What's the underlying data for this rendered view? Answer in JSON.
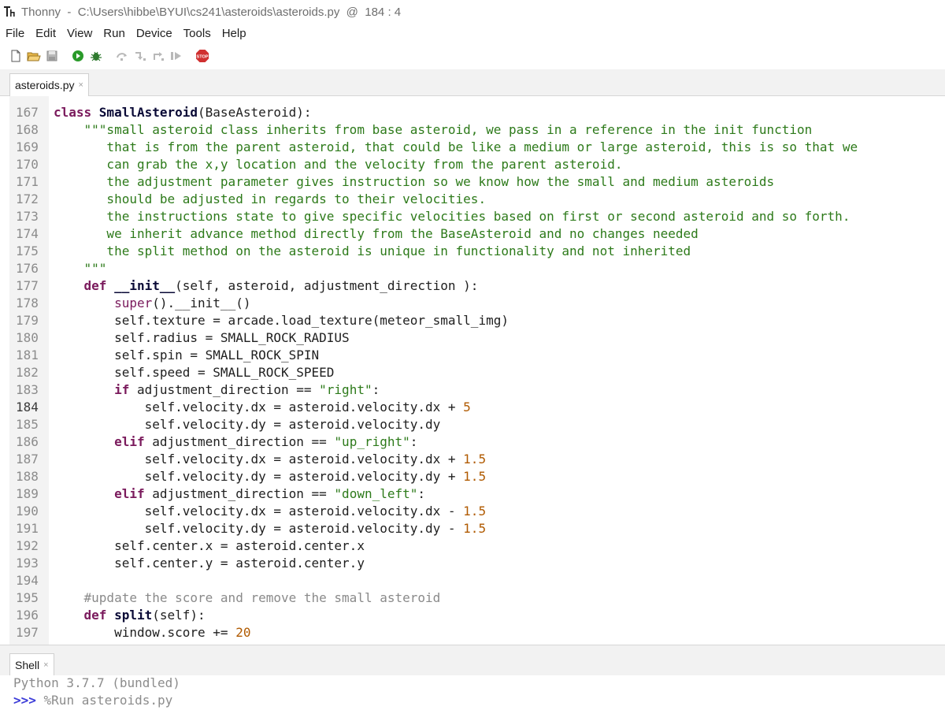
{
  "window": {
    "title": "Thonny  -  C:\\Users\\hibbe\\BYUI\\cs241\\asteroids\\asteroids.py  @  184 : 4"
  },
  "menu": [
    "File",
    "Edit",
    "View",
    "Run",
    "Device",
    "Tools",
    "Help"
  ],
  "toolbar": {
    "icons": [
      "new-file-icon",
      "open-file-icon",
      "save-icon",
      "run-icon",
      "debug-icon",
      "step-over-icon",
      "step-into-icon",
      "step-out-icon",
      "resume-icon",
      "stop-icon"
    ],
    "stop_label": "STOP"
  },
  "editor": {
    "tab_label": "asteroids.py",
    "tab_close": "×",
    "current_line": 184,
    "lines": [
      {
        "n": "167",
        "tokens": [
          {
            "t": "kw",
            "v": "class "
          },
          {
            "t": "def",
            "v": "SmallAsteroid"
          },
          {
            "t": "plain",
            "v": "(BaseAsteroid):"
          }
        ]
      },
      {
        "n": "168",
        "tokens": [
          {
            "t": "plain",
            "v": "    "
          },
          {
            "t": "str",
            "v": "\"\"\"small asteroid class inherits from base asteroid, we pass in a reference in the init function"
          }
        ]
      },
      {
        "n": "169",
        "tokens": [
          {
            "t": "str",
            "v": "       that is from the parent asteroid, that could be like a medium or large asteroid, this is so that we"
          }
        ]
      },
      {
        "n": "170",
        "tokens": [
          {
            "t": "str",
            "v": "       can grab the x,y location and the velocity from the parent asteroid."
          }
        ]
      },
      {
        "n": "171",
        "tokens": [
          {
            "t": "str",
            "v": "       the adjustment parameter gives instruction so we know how the small and medium asteroids"
          }
        ]
      },
      {
        "n": "172",
        "tokens": [
          {
            "t": "str",
            "v": "       should be adjusted in regards to their velocities."
          }
        ]
      },
      {
        "n": "173",
        "tokens": [
          {
            "t": "str",
            "v": "       the instructions state to give specific velocities based on first or second asteroid and so forth."
          }
        ]
      },
      {
        "n": "174",
        "tokens": [
          {
            "t": "str",
            "v": "       we inherit advance method directly from the BaseAsteroid and no changes needed"
          }
        ]
      },
      {
        "n": "175",
        "tokens": [
          {
            "t": "str",
            "v": "       the split method on the asteroid is unique in functionality and not inherited"
          }
        ]
      },
      {
        "n": "176",
        "tokens": [
          {
            "t": "str",
            "v": "    \"\"\""
          }
        ]
      },
      {
        "n": "177",
        "tokens": [
          {
            "t": "plain",
            "v": "    "
          },
          {
            "t": "kw",
            "v": "def "
          },
          {
            "t": "def",
            "v": "__init__"
          },
          {
            "t": "plain",
            "v": "(self, asteroid, adjustment_direction ):"
          }
        ]
      },
      {
        "n": "178",
        "tokens": [
          {
            "t": "plain",
            "v": "        "
          },
          {
            "t": "builtin",
            "v": "super"
          },
          {
            "t": "plain",
            "v": "().__init__()"
          }
        ]
      },
      {
        "n": "179",
        "tokens": [
          {
            "t": "plain",
            "v": "        self.texture = arcade.load_texture(meteor_small_img)"
          }
        ]
      },
      {
        "n": "180",
        "tokens": [
          {
            "t": "plain",
            "v": "        self.radius = SMALL_ROCK_RADIUS"
          }
        ]
      },
      {
        "n": "181",
        "tokens": [
          {
            "t": "plain",
            "v": "        self.spin = SMALL_ROCK_SPIN"
          }
        ]
      },
      {
        "n": "182",
        "tokens": [
          {
            "t": "plain",
            "v": "        self.speed = SMALL_ROCK_SPEED"
          }
        ]
      },
      {
        "n": "183",
        "tokens": [
          {
            "t": "plain",
            "v": "        "
          },
          {
            "t": "kw",
            "v": "if"
          },
          {
            "t": "plain",
            "v": " adjustment_direction == "
          },
          {
            "t": "str",
            "v": "\"right\""
          },
          {
            "t": "plain",
            "v": ":"
          }
        ]
      },
      {
        "n": "184",
        "tokens": [
          {
            "t": "plain",
            "v": "            self.velocity.dx = asteroid.velocity.dx + "
          },
          {
            "t": "num",
            "v": "5"
          }
        ]
      },
      {
        "n": "185",
        "tokens": [
          {
            "t": "plain",
            "v": "            self.velocity.dy = asteroid.velocity.dy"
          }
        ]
      },
      {
        "n": "186",
        "tokens": [
          {
            "t": "plain",
            "v": "        "
          },
          {
            "t": "kw",
            "v": "elif"
          },
          {
            "t": "plain",
            "v": " adjustment_direction == "
          },
          {
            "t": "str",
            "v": "\"up_right\""
          },
          {
            "t": "plain",
            "v": ":"
          }
        ]
      },
      {
        "n": "187",
        "tokens": [
          {
            "t": "plain",
            "v": "            self.velocity.dx = asteroid.velocity.dx + "
          },
          {
            "t": "num",
            "v": "1.5"
          }
        ]
      },
      {
        "n": "188",
        "tokens": [
          {
            "t": "plain",
            "v": "            self.velocity.dy = asteroid.velocity.dy + "
          },
          {
            "t": "num",
            "v": "1.5"
          }
        ]
      },
      {
        "n": "189",
        "tokens": [
          {
            "t": "plain",
            "v": "        "
          },
          {
            "t": "kw",
            "v": "elif"
          },
          {
            "t": "plain",
            "v": " adjustment_direction == "
          },
          {
            "t": "str",
            "v": "\"down_left\""
          },
          {
            "t": "plain",
            "v": ":"
          }
        ]
      },
      {
        "n": "190",
        "tokens": [
          {
            "t": "plain",
            "v": "            self.velocity.dx = asteroid.velocity.dx - "
          },
          {
            "t": "num",
            "v": "1.5"
          }
        ]
      },
      {
        "n": "191",
        "tokens": [
          {
            "t": "plain",
            "v": "            self.velocity.dy = asteroid.velocity.dy - "
          },
          {
            "t": "num",
            "v": "1.5"
          }
        ]
      },
      {
        "n": "192",
        "tokens": [
          {
            "t": "plain",
            "v": "        self.center.x = asteroid.center.x"
          }
        ]
      },
      {
        "n": "193",
        "tokens": [
          {
            "t": "plain",
            "v": "        self.center.y = asteroid.center.y"
          }
        ]
      },
      {
        "n": "194",
        "tokens": []
      },
      {
        "n": "195",
        "tokens": [
          {
            "t": "plain",
            "v": "    "
          },
          {
            "t": "cmt",
            "v": "#update the score and remove the small asteroid"
          }
        ]
      },
      {
        "n": "196",
        "tokens": [
          {
            "t": "plain",
            "v": "    "
          },
          {
            "t": "kw",
            "v": "def "
          },
          {
            "t": "def",
            "v": "split"
          },
          {
            "t": "plain",
            "v": "(self):"
          }
        ]
      },
      {
        "n": "197",
        "tokens": [
          {
            "t": "plain",
            "v": "        window.score += "
          },
          {
            "t": "num",
            "v": "20"
          }
        ]
      }
    ]
  },
  "shell": {
    "tab_label": "Shell",
    "tab_close": "×",
    "banner": "Python 3.7.7 (bundled)",
    "prompt": ">>>",
    "command": " %Run asteroids.py"
  },
  "colors": {
    "keyword": "#7a1a5c",
    "string": "#2d7a1a",
    "number": "#b05a00",
    "comment": "#8a8a8a",
    "prompt": "#3b3bd8",
    "run_green": "#2a9a2a",
    "stop_red": "#d03030"
  }
}
